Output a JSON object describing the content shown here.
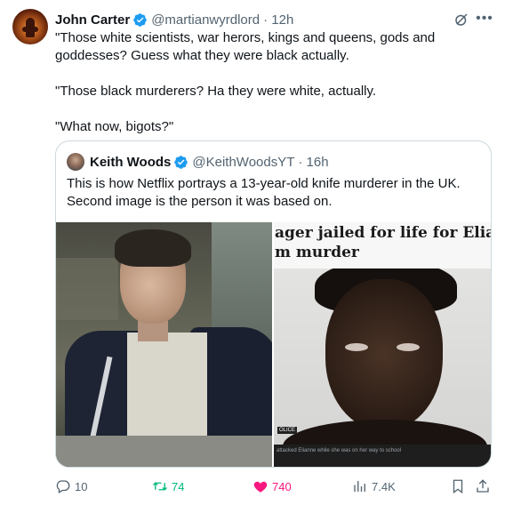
{
  "tweet": {
    "author_name": "John Carter",
    "author_handle": "@martianwyrdlord",
    "time": "· 12h",
    "lines": [
      "\"Those white scientists, war herors, kings and queens, gods and goddesses? Guess what they were black actually.",
      "\"Those black murderers? Ha they were white, actually.",
      "\"What now, bigots?\""
    ]
  },
  "quote": {
    "author_name": "Keith Woods",
    "author_handle": "@KeithWoodsYT",
    "time": "· 16h",
    "text": "This is how Netflix portrays a 13-year-old knife murderer in the UK. Second image is the person it was based on.",
    "image_right": {
      "headline_line1": "ager jailed for life for Eliann",
      "headline_line2": "m murder",
      "tag": "OLICE",
      "caption": "attacked Elianne while she was on her way to school"
    }
  },
  "actions": {
    "replies": "10",
    "retweets": "74",
    "likes": "740",
    "views": "7.4K"
  },
  "colors": {
    "verified": "#1d9bf0",
    "like": "#f91880",
    "retweet": "#00ba7c",
    "secondary": "#536471"
  },
  "icons": [
    "verified-badge-icon",
    "grok-icon",
    "more-icon",
    "reply-icon",
    "retweet-icon",
    "like-icon",
    "views-icon",
    "bookmark-icon",
    "share-icon"
  ]
}
